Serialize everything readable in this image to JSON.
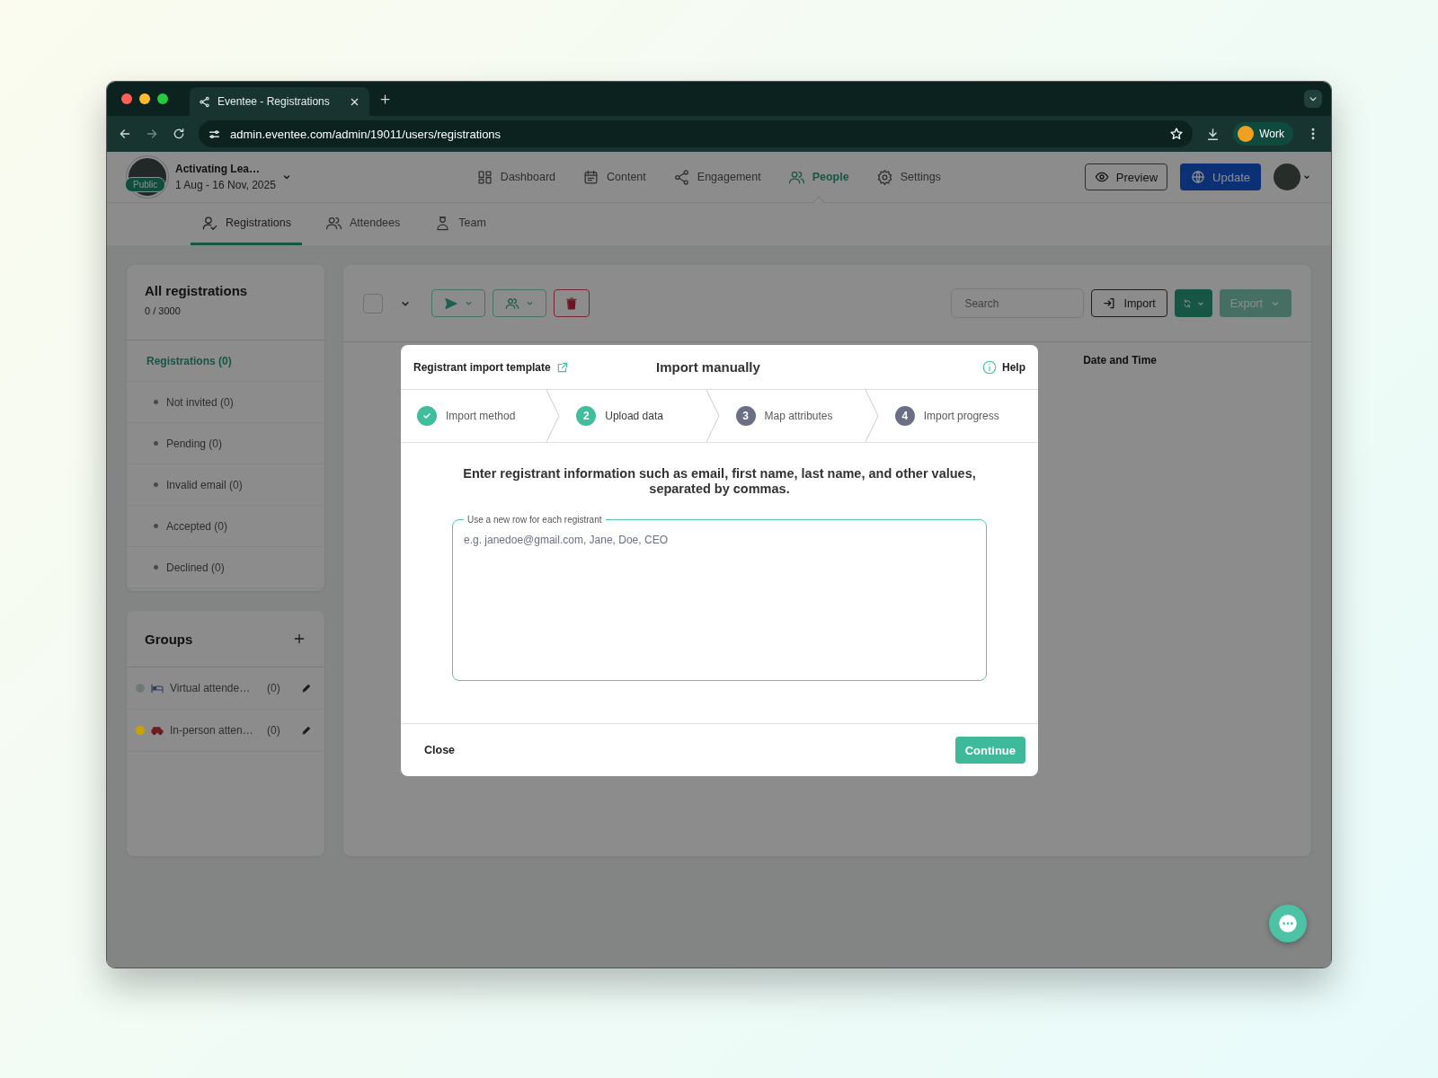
{
  "browser": {
    "tab_title": "Eventee - Registrations",
    "url": "admin.eventee.com/admin/19011/users/registrations",
    "profile": "Work"
  },
  "header": {
    "event_name": "Activating Lea…",
    "event_dates": "1 Aug - 16 Nov, 2025",
    "badge": "Public",
    "nav": [
      {
        "label": "Dashboard",
        "selected": false
      },
      {
        "label": "Content",
        "selected": false
      },
      {
        "label": "Engagement",
        "selected": false
      },
      {
        "label": "People",
        "selected": true
      },
      {
        "label": "Settings",
        "selected": false
      }
    ],
    "preview": "Preview",
    "update": "Update"
  },
  "subnav": [
    {
      "label": "Registrations",
      "selected": true
    },
    {
      "label": "Attendees",
      "selected": false
    },
    {
      "label": "Team",
      "selected": false
    }
  ],
  "sidebar": {
    "title": "All registrations",
    "count": "0 / 3000",
    "filters": [
      {
        "label": "Registrations (0)",
        "selected": true,
        "children": [
          {
            "label": "Not invited (0)",
            "selected": false
          },
          {
            "label": "Pending (0)",
            "selected": false
          },
          {
            "label": "Invalid email (0)",
            "selected": false
          },
          {
            "label": "Accepted (0)",
            "selected": false
          },
          {
            "label": "Declined (0)",
            "selected": false
          }
        ]
      }
    ],
    "groups": {
      "title": "Groups",
      "items": [
        {
          "name": "Virtual attende…",
          "count": "(0)",
          "color": "#6e7876"
        },
        {
          "name": "In-person atten…",
          "count": "(0)",
          "color": "#c9a300"
        }
      ]
    }
  },
  "toolbar": {
    "select_all": {
      "checked": false
    },
    "search_placeholder": "Search",
    "import": "Import",
    "export": "Export"
  },
  "table": {
    "columns": [
      "Date and Time"
    ]
  },
  "modal": {
    "template_link": "Registrant import template",
    "title": "Import manually",
    "help": "Help",
    "steps": [
      {
        "label": "Import method",
        "completed": true,
        "selected": false
      },
      {
        "number": "2",
        "label": "Upload data",
        "completed": false,
        "selected": true
      },
      {
        "number": "3",
        "label": "Map attributes",
        "completed": false,
        "selected": false
      },
      {
        "number": "4",
        "label": "Import progress",
        "completed": false,
        "selected": false
      }
    ],
    "instruction": "Enter registrant information such as email, first name, last name, and other values, separated by commas.",
    "field_label": "Use a new row for each registrant",
    "placeholder": "e.g. janedoe@gmail.com, Jane, Doe, CEO",
    "close": "Close",
    "continue": "Continue"
  }
}
